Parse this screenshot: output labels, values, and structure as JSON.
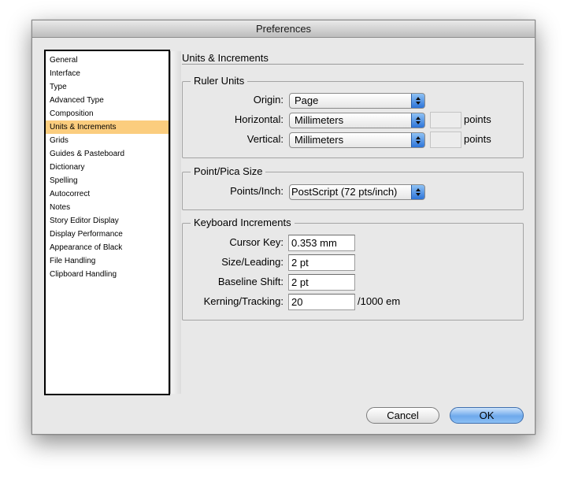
{
  "window": {
    "title": "Preferences"
  },
  "sidebar": {
    "items": [
      {
        "label": "General"
      },
      {
        "label": "Interface"
      },
      {
        "label": "Type"
      },
      {
        "label": "Advanced Type"
      },
      {
        "label": "Composition"
      },
      {
        "label": "Units & Increments",
        "selected": true
      },
      {
        "label": "Grids"
      },
      {
        "label": "Guides & Pasteboard"
      },
      {
        "label": "Dictionary"
      },
      {
        "label": "Spelling"
      },
      {
        "label": "Autocorrect"
      },
      {
        "label": "Notes"
      },
      {
        "label": "Story Editor Display"
      },
      {
        "label": "Display Performance"
      },
      {
        "label": "Appearance of Black"
      },
      {
        "label": "File Handling"
      },
      {
        "label": "Clipboard Handling"
      }
    ]
  },
  "panel": {
    "title": "Units & Increments",
    "ruler_units": {
      "legend": "Ruler Units",
      "origin_label": "Origin:",
      "origin_value": "Page",
      "horizontal_label": "Horizontal:",
      "horizontal_value": "Millimeters",
      "horizontal_points": "",
      "horizontal_unit": "points",
      "vertical_label": "Vertical:",
      "vertical_value": "Millimeters",
      "vertical_points": "",
      "vertical_unit": "points"
    },
    "point_pica": {
      "legend": "Point/Pica Size",
      "points_per_inch_label": "Points/Inch:",
      "points_per_inch_value": "PostScript (72 pts/inch)"
    },
    "keyboard": {
      "legend": "Keyboard Increments",
      "cursor_key_label": "Cursor Key:",
      "cursor_key_value": "0.353 mm",
      "size_leading_label": "Size/Leading:",
      "size_leading_value": "2 pt",
      "baseline_shift_label": "Baseline Shift:",
      "baseline_shift_value": "2 pt",
      "kerning_label": "Kerning/Tracking:",
      "kerning_value": "20",
      "kerning_unit": "/1000 em"
    }
  },
  "buttons": {
    "cancel": "Cancel",
    "ok": "OK"
  },
  "colors": {
    "selection": "#fbcd7e",
    "accent": "#2d74d8"
  }
}
